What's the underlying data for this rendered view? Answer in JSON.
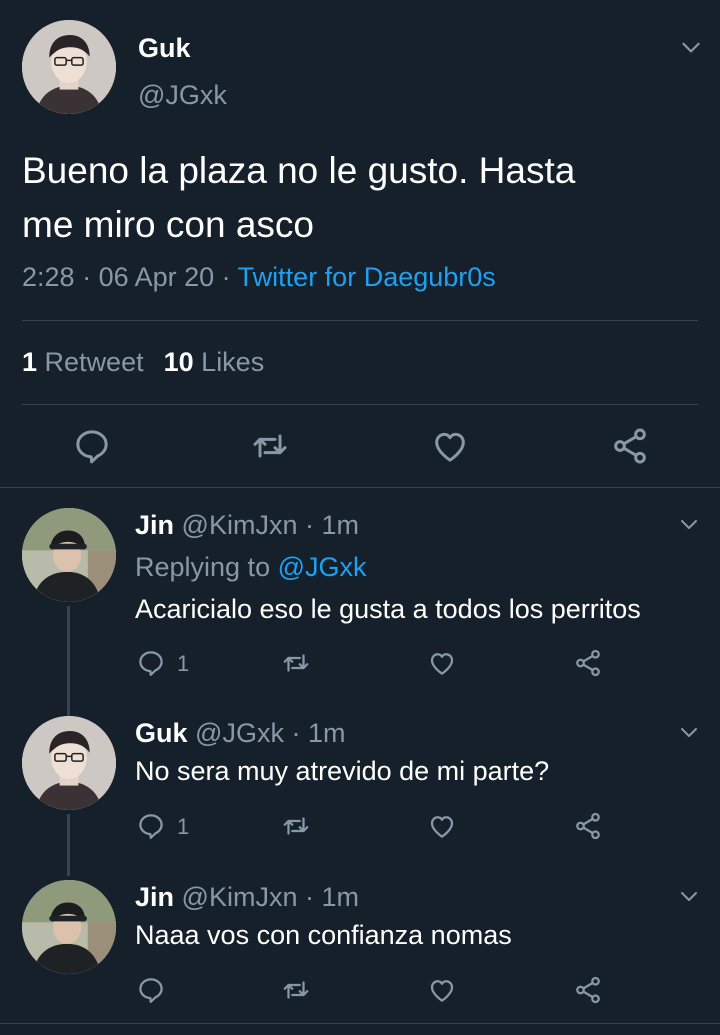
{
  "main": {
    "name": "Guk",
    "handle": "@JGxk",
    "text_line1": "Bueno la plaza no le gusto. Hasta",
    "text_line2": "me miro con asco",
    "time": "2:28",
    "date": "06 Apr 20",
    "separator": " · ",
    "source": "Twitter for Daegubr0s",
    "retweets_count": "1",
    "retweets_label": "Retweet",
    "likes_count": "10",
    "likes_label": "Likes",
    "actions": [
      "reply-icon",
      "retweet-icon",
      "like-icon",
      "share-icon"
    ]
  },
  "replies": [
    {
      "name": "Jin",
      "handle": "@KimJxn",
      "dot": " · ",
      "time": "1m",
      "replying_label": "Replying to ",
      "replying_handle": "@JGxk",
      "text": "Acaricialo eso le gusta a todos los perritos",
      "reply_count": "1"
    },
    {
      "name": "Guk",
      "handle": "@JGxk",
      "dot": " · ",
      "time": "1m",
      "text": "No sera muy atrevido de mi parte?",
      "reply_count": "1"
    },
    {
      "name": "Jin",
      "handle": "@KimJxn",
      "dot": " · ",
      "time": "1m",
      "text": "Naaa vos con confianza nomas",
      "reply_count": ""
    }
  ],
  "colors": {
    "background": "#15202b",
    "secondary_text": "#8899a6",
    "accent": "#1da1f2",
    "divider": "#38444d"
  }
}
